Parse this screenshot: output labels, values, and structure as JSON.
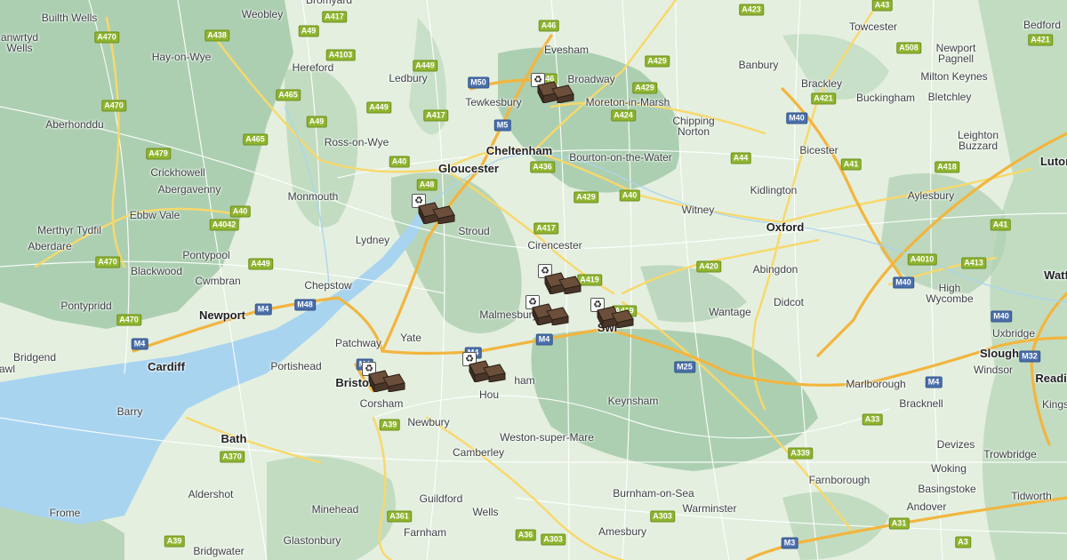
{
  "map": {
    "colors": {
      "water": "#a8d4f0",
      "land": "#e4efdf",
      "hills": "#7fb58a",
      "minor_road": "#ffffff",
      "motorway": "#f2b53e",
      "a_road": "#f8d86a"
    },
    "places": [
      {
        "name": "Builth Wells",
        "size": "small"
      },
      {
        "name": "Weobley",
        "size": "small"
      },
      {
        "name": "Bromyard",
        "size": "small"
      },
      {
        "name": "Evesham",
        "size": "small"
      },
      {
        "name": "Towcester",
        "size": "small"
      },
      {
        "name": "Bedford",
        "size": "small"
      },
      {
        "name": "anwrtyd\nWells",
        "size": "small"
      },
      {
        "name": "Hay-on-Wye",
        "size": "small"
      },
      {
        "name": "Hereford",
        "size": "small"
      },
      {
        "name": "Ledbury",
        "size": "small"
      },
      {
        "name": "Broadway",
        "size": "small"
      },
      {
        "name": "Banbury",
        "size": "small"
      },
      {
        "name": "Newport\nPagnell",
        "size": "small"
      },
      {
        "name": "Milton Keynes",
        "size": "small"
      },
      {
        "name": "Tewkesbury",
        "size": "small"
      },
      {
        "name": "Moreton-in-Marsh",
        "size": "small"
      },
      {
        "name": "Brackley",
        "size": "small"
      },
      {
        "name": "Buckingham",
        "size": "small"
      },
      {
        "name": "Bletchley",
        "size": "small"
      },
      {
        "name": "Aberhonddu",
        "size": "small"
      },
      {
        "name": "Ross-on-Wye",
        "size": "small"
      },
      {
        "name": "Chipping\nNorton",
        "size": "small"
      },
      {
        "name": "Leighton\nBuzzard",
        "size": "small"
      },
      {
        "name": "Cheltenham",
        "size": "big"
      },
      {
        "name": "Bourton-on-the-Water",
        "size": "small"
      },
      {
        "name": "Bicester",
        "size": "small"
      },
      {
        "name": "Luton",
        "size": "big"
      },
      {
        "name": "Crickhowell",
        "size": "small"
      },
      {
        "name": "Gloucester",
        "size": "big"
      },
      {
        "name": "Abergavenny",
        "size": "small"
      },
      {
        "name": "Monmouth",
        "size": "small"
      },
      {
        "name": "Kidlington",
        "size": "small"
      },
      {
        "name": "Aylesbury",
        "size": "small"
      },
      {
        "name": "Ebbw Vale",
        "size": "small"
      },
      {
        "name": "Merthyr Tydfil",
        "size": "small"
      },
      {
        "name": "Witney",
        "size": "small"
      },
      {
        "name": "Oxford",
        "size": "big"
      },
      {
        "name": "Aberdare",
        "size": "small"
      },
      {
        "name": "Stroud",
        "size": "small"
      },
      {
        "name": "Cirencester",
        "size": "small"
      },
      {
        "name": "Lydney",
        "size": "small"
      },
      {
        "name": "Pontypool",
        "size": "small"
      },
      {
        "name": "Blackwood",
        "size": "small"
      },
      {
        "name": "Abingdon",
        "size": "small"
      },
      {
        "name": "Cwmbran",
        "size": "small"
      },
      {
        "name": "Chepstow",
        "size": "small"
      },
      {
        "name": "High\nWycombe",
        "size": "small"
      },
      {
        "name": "Watf",
        "size": "big"
      },
      {
        "name": "Pontypridd",
        "size": "small"
      },
      {
        "name": "Malmesbury",
        "size": "small"
      },
      {
        "name": "Didcot",
        "size": "small"
      },
      {
        "name": "Newport",
        "size": "big"
      },
      {
        "name": "Wantage",
        "size": "small"
      },
      {
        "name": "Swi",
        "size": "big"
      },
      {
        "name": "Uxbridge",
        "size": "small"
      },
      {
        "name": "Yate",
        "size": "small"
      },
      {
        "name": "Patchway",
        "size": "small"
      },
      {
        "name": "Slough",
        "size": "big"
      },
      {
        "name": "Bridgend",
        "size": "small"
      },
      {
        "name": "Cardiff",
        "size": "big"
      },
      {
        "name": "Portishead",
        "size": "small"
      },
      {
        "name": "Windsor",
        "size": "small"
      },
      {
        "name": "awl",
        "size": "small"
      },
      {
        "name": "Bristol",
        "size": "big"
      },
      {
        "name": "ham",
        "size": "small"
      },
      {
        "name": "Reading",
        "size": "big"
      },
      {
        "name": "Hou",
        "size": "small"
      },
      {
        "name": "Corsham",
        "size": "small"
      },
      {
        "name": "Keynsham",
        "size": "small"
      },
      {
        "name": "Marlborough",
        "size": "small"
      },
      {
        "name": "Bracknell",
        "size": "small"
      },
      {
        "name": "Kings",
        "size": "small"
      },
      {
        "name": "Barry",
        "size": "small"
      },
      {
        "name": "Newbury",
        "size": "small"
      },
      {
        "name": "Bath",
        "size": "big"
      },
      {
        "name": "Weston-super-Mare",
        "size": "small"
      },
      {
        "name": "Devizes",
        "size": "small"
      },
      {
        "name": "Camberley",
        "size": "small"
      },
      {
        "name": "Trowbridge",
        "size": "small"
      },
      {
        "name": "Woking",
        "size": "small"
      },
      {
        "name": "Farnborough",
        "size": "small"
      },
      {
        "name": "Basingstoke",
        "size": "small"
      },
      {
        "name": "Aldershot",
        "size": "small"
      },
      {
        "name": "Burnham-on-Sea",
        "size": "small"
      },
      {
        "name": "Tidworth",
        "size": "small"
      },
      {
        "name": "Guildford",
        "size": "small"
      },
      {
        "name": "Frome",
        "size": "small"
      },
      {
        "name": "Minehead",
        "size": "small"
      },
      {
        "name": "Wells",
        "size": "small"
      },
      {
        "name": "Warminster",
        "size": "small"
      },
      {
        "name": "Andover",
        "size": "small"
      },
      {
        "name": "Farnham",
        "size": "small"
      },
      {
        "name": "Amesbury",
        "size": "small"
      },
      {
        "name": "Glastonbury",
        "size": "small"
      },
      {
        "name": "Bridgwater",
        "size": "small"
      }
    ],
    "roads": [
      {
        "label": "A417",
        "type": "a"
      },
      {
        "label": "A49",
        "type": "a"
      },
      {
        "label": "A46",
        "type": "a"
      },
      {
        "label": "A423",
        "type": "a"
      },
      {
        "label": "A43",
        "type": "a"
      },
      {
        "label": "A470",
        "type": "a"
      },
      {
        "label": "A438",
        "type": "a"
      },
      {
        "label": "A4103",
        "type": "a"
      },
      {
        "label": "A449",
        "type": "a"
      },
      {
        "label": "A429",
        "type": "a"
      },
      {
        "label": "A508",
        "type": "a"
      },
      {
        "label": "A421",
        "type": "a"
      },
      {
        "label": "M50",
        "type": "m"
      },
      {
        "label": "A46",
        "type": "a"
      },
      {
        "label": "A429",
        "type": "a"
      },
      {
        "label": "A465",
        "type": "a"
      },
      {
        "label": "A421",
        "type": "a"
      },
      {
        "label": "A470",
        "type": "a"
      },
      {
        "label": "A449",
        "type": "a"
      },
      {
        "label": "A417",
        "type": "a"
      },
      {
        "label": "A424",
        "type": "a"
      },
      {
        "label": "M40",
        "type": "m"
      },
      {
        "label": "A49",
        "type": "a"
      },
      {
        "label": "M5",
        "type": "m"
      },
      {
        "label": "A465",
        "type": "a"
      },
      {
        "label": "A479",
        "type": "a"
      },
      {
        "label": "A44",
        "type": "a"
      },
      {
        "label": "A40",
        "type": "a"
      },
      {
        "label": "A436",
        "type": "a"
      },
      {
        "label": "A41",
        "type": "a"
      },
      {
        "label": "A418",
        "type": "a"
      },
      {
        "label": "A48",
        "type": "a"
      },
      {
        "label": "A429",
        "type": "a"
      },
      {
        "label": "A40",
        "type": "a"
      },
      {
        "label": "A40",
        "type": "a"
      },
      {
        "label": "A4042",
        "type": "a"
      },
      {
        "label": "A417",
        "type": "a"
      },
      {
        "label": "A41",
        "type": "a"
      },
      {
        "label": "A470",
        "type": "a"
      },
      {
        "label": "A449",
        "type": "a"
      },
      {
        "label": "A420",
        "type": "a"
      },
      {
        "label": "A4010",
        "type": "a"
      },
      {
        "label": "A413",
        "type": "a"
      },
      {
        "label": "A419",
        "type": "a"
      },
      {
        "label": "M40",
        "type": "m"
      },
      {
        "label": "M48",
        "type": "m"
      },
      {
        "label": "A419",
        "type": "a"
      },
      {
        "label": "M4",
        "type": "m"
      },
      {
        "label": "A470",
        "type": "a"
      },
      {
        "label": "M40",
        "type": "m"
      },
      {
        "label": "M4",
        "type": "m"
      },
      {
        "label": "M4",
        "type": "m"
      },
      {
        "label": "M4",
        "type": "m"
      },
      {
        "label": "M25",
        "type": "m"
      },
      {
        "label": "M32",
        "type": "m"
      },
      {
        "label": "M4",
        "type": "m"
      },
      {
        "label": "M4",
        "type": "m"
      },
      {
        "label": "A39",
        "type": "a"
      },
      {
        "label": "A33",
        "type": "a"
      },
      {
        "label": "A370",
        "type": "a"
      },
      {
        "label": "A339",
        "type": "a"
      },
      {
        "label": "A361",
        "type": "a"
      },
      {
        "label": "A303",
        "type": "a"
      },
      {
        "label": "A31",
        "type": "a"
      },
      {
        "label": "A39",
        "type": "a"
      },
      {
        "label": "A36",
        "type": "a"
      },
      {
        "label": "A303",
        "type": "a"
      },
      {
        "label": "M3",
        "type": "m"
      },
      {
        "label": "A3",
        "type": "a"
      }
    ],
    "markers": [
      {
        "name": "recycling-centre",
        "icon": "♻"
      },
      {
        "name": "recycling-centre",
        "icon": "♻"
      },
      {
        "name": "recycling-centre",
        "icon": "♻"
      },
      {
        "name": "recycling-centre",
        "icon": "♻"
      },
      {
        "name": "recycling-centre",
        "icon": "♻"
      },
      {
        "name": "recycling-centre",
        "icon": "♻"
      },
      {
        "name": "recycling-centre",
        "icon": "♻"
      }
    ]
  }
}
